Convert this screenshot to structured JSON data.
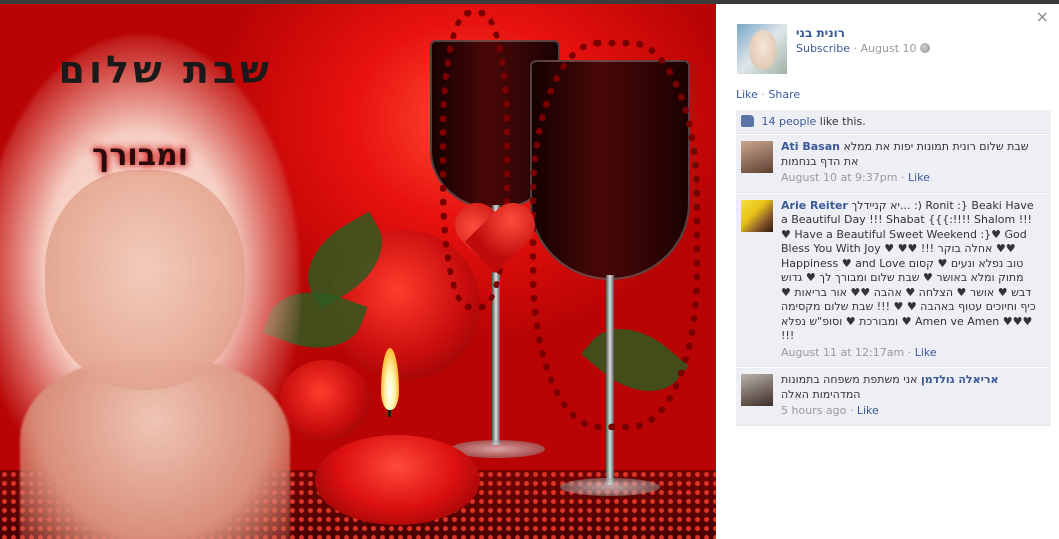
{
  "photo": {
    "overlay_title": "שבת שלום",
    "overlay_subtitle": "ומבורך"
  },
  "viewer": {
    "close_glyph": "×"
  },
  "owner": {
    "name": "רונית בני",
    "subscribe_label": "Subscribe",
    "separator": "·",
    "date": "August 10",
    "audience_icon": "globe-icon"
  },
  "actions": {
    "like_label": "Like",
    "separator": "·",
    "share_label": "Share"
  },
  "likes": {
    "icon": "thumbs-up-icon",
    "count_label": "14 people",
    "suffix": "like this."
  },
  "comments": [
    {
      "author": "Ati Basan",
      "text": "שבת שלום רונית תמונות יפות את ממלא את הדף בנחמות",
      "time": "August 10 at 9:37pm",
      "like_label": "Like"
    },
    {
      "author": "Arie Reiter",
      "text": "יא קניידלך... :) Ronit :} Beaki Have a Beautiful Day !!! Shabat {{{:!!!! Shalom !!! ♥ Have a Beautiful Sweet Weekend :}♥ God Bless You With Joy ♥ ♥♥ !!! אחלה בוקר ♥♥ Happiness ♥ and Love טוב נפלא ונעים ♥ קסום מתוק ומלא באושר ♥ שבת שלום ומבורך לך ♥ גדוש דבש ♥ אושר ♥ הצלחה ♥ אהבה ♥♥ אור בריאות ♥ כיף וחיוכים עטוף באהבה ♥ ♥ !!! שבת שלום מקסימה ומבורכת ♥ וסופ\"ש נפלא ♥ Amen ve Amen ♥♥♥ !!!",
      "time": "August 11 at 12:17am",
      "like_label": "Like"
    },
    {
      "author": "אריאלה גולדמן",
      "text": "אני משתפת משפחה בתמונות המדהימות האלה",
      "time": "5 hours ago",
      "like_label": "Like"
    }
  ]
}
